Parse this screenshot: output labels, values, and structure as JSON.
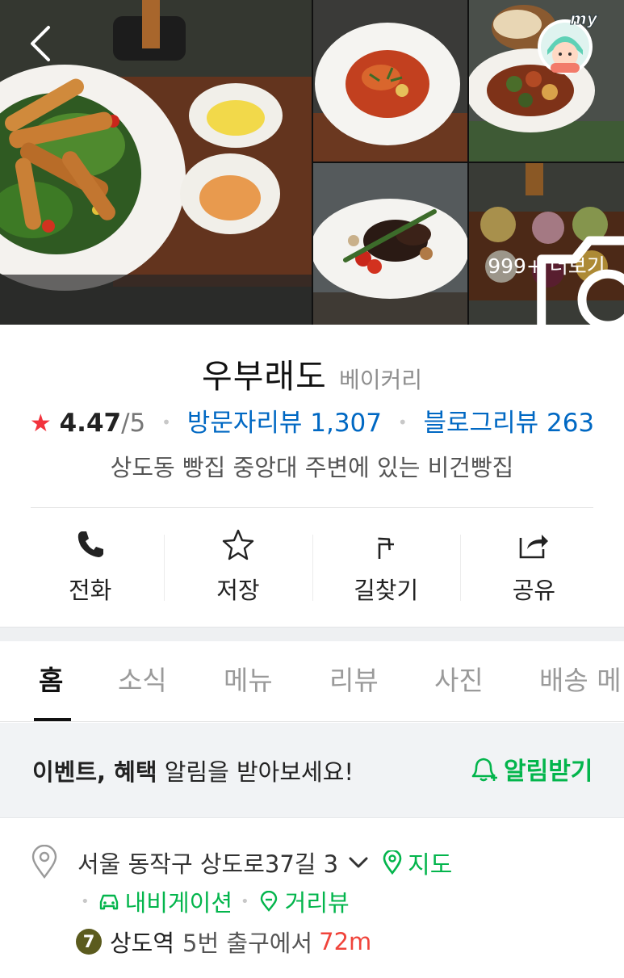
{
  "gallery": {
    "back_icon": "chevron-left-icon",
    "my_icon": "my-avatar-icon",
    "my_label": "my",
    "more_label": "999+ 더보기",
    "more_icon": "camera-icon"
  },
  "place": {
    "name": "우부래도",
    "category": "베이커리",
    "rating": "4.47",
    "rating_max": "/5",
    "visitor_review_label": "방문자리뷰 1,307",
    "blog_review_label": "블로그리뷰 263",
    "description": "상도동 빵집 중앙대 주변에 있는 비건빵집"
  },
  "actions": [
    {
      "label": "전화",
      "icon": "phone-icon"
    },
    {
      "label": "저장",
      "icon": "star-outline-icon"
    },
    {
      "label": "길찾기",
      "icon": "directions-icon"
    },
    {
      "label": "공유",
      "icon": "share-icon"
    }
  ],
  "tabs": [
    {
      "label": "홈",
      "active": true
    },
    {
      "label": "소식",
      "active": false
    },
    {
      "label": "메뉴",
      "active": false
    },
    {
      "label": "리뷰",
      "active": false
    },
    {
      "label": "사진",
      "active": false
    },
    {
      "label": "배송 메",
      "active": false
    }
  ],
  "alarm": {
    "bold_text": "이벤트, 혜택",
    "text": " 알림을 받아보세요!",
    "button_label": "알림받기",
    "icon": "bell-plus-icon"
  },
  "location": {
    "address": "서울 동작구 상도로37길 3",
    "map_label": "지도",
    "navigation_label": "내비게이션",
    "streetview_label": "거리뷰",
    "line_number": "7",
    "station": "상도역",
    "exit": "5번 출구에서",
    "distance": "72m"
  },
  "colors": {
    "accent_green": "#03b54c",
    "link_blue": "#0068c3",
    "star_red": "#f2333d",
    "distance_red": "#f0443b",
    "line7_olive": "#5b5b1e"
  }
}
